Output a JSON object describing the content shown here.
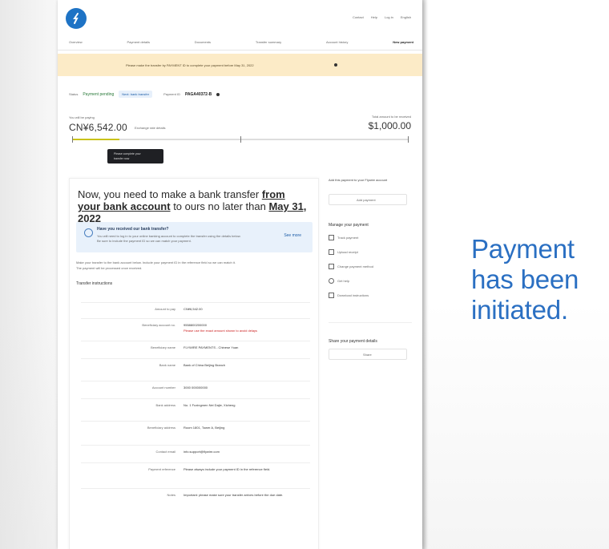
{
  "header": {
    "top_links": [
      "Contact",
      "Help",
      "Log in",
      "English"
    ],
    "nav_items": [
      "Overview",
      "Payment details",
      "Documents",
      "Transfer summary",
      "Account history",
      "New payment"
    ]
  },
  "banner": {
    "text": "Please make the transfer by PAYMENT ID to complete your payment before May 31, 2022"
  },
  "status": {
    "label": "Status",
    "badge": "Payment pending",
    "chip": "Next: bank transfer",
    "ref_label": "Payment ID",
    "ref_value": "PAGA40372-B"
  },
  "balances": {
    "left_caption": "You will be paying",
    "left_amount": "CN¥6,542.00",
    "left_note": "Exchange rate details",
    "right_caption": "Total amount to be received",
    "right_amount": "$1,000.00",
    "progress_fraction": 0.14
  },
  "tooltip": {
    "line1": "Please complete your",
    "line2": "transfer now"
  },
  "main": {
    "headline_pre": "Now, you need to make a bank transfer ",
    "headline_link1": "from your bank account",
    "headline_mid": " to ours no later than ",
    "headline_link2": "May 31, 2022",
    "info_title": "Have you received our bank transfer?",
    "info_line1": "You will need to log in to your online banking account to complete the transfer using the details below.",
    "info_line2": "Be sure to include the payment ID so we can match your payment.",
    "info_link": "See more",
    "para1": "Make your transfer to the bank account below. Include your payment ID in the reference field so we can match it.",
    "para2": "The payment will be processed once received.",
    "section_title": "Transfer instructions",
    "rows": [
      {
        "label": "Amount to pay",
        "value": "CN¥6,542.00"
      },
      {
        "label": "Beneficiary account no.",
        "value": "9558800200000",
        "note": "Please use the exact amount shown to avoid delays"
      },
      {
        "label": "Beneficiary name",
        "value": "FLYWIRE PAYMENTS - Chinese Yuan"
      },
      {
        "label": "Bank name",
        "value": "Bank of China Beijing Branch"
      },
      {
        "label": "Account number",
        "value": "3000 000000000"
      },
      {
        "label": "Bank address",
        "value": "No. 1 Fuxingmen Nei Dajie, Xicheng"
      },
      {
        "label": "Beneficiary address",
        "value": "Room 1801, Tower A, Beijing"
      },
      {
        "label": "Contact email",
        "value": "info.support@flywire.com"
      },
      {
        "label": "Payment reference",
        "value": "Please always include your payment ID in the reference field."
      },
      {
        "label": "Notes",
        "value": "Important: please make sure your transfer arrives before the due date."
      }
    ]
  },
  "side": {
    "add_title": "Add this payment to your Flywire account",
    "add_button": "Add payment",
    "manage_title": "Manage your payment",
    "manage_items": [
      "Track payment",
      "Upload receipt",
      "Change payment method",
      "Get help",
      "Download instructions"
    ],
    "share_title": "Share your payment details",
    "share_button": "Share"
  },
  "caption": {
    "line1": "Payment",
    "line2": "has been",
    "line3": "initiated."
  }
}
